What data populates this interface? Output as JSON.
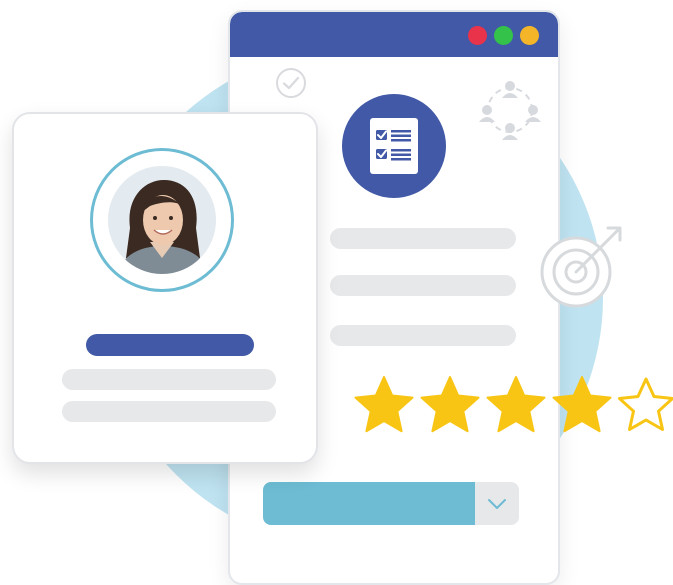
{
  "colors": {
    "primary_blue": "#4159a6",
    "accent_teal": "#6dbcd3",
    "light_blue_bg": "#bfe3f1",
    "placeholder_gray": "#e7e8ea",
    "star_gold": "#f8c514",
    "window_red": "#e8334a",
    "window_green": "#34c24a",
    "window_yellow": "#f4b628"
  },
  "icons": {
    "window_controls": [
      "close-dot",
      "maximize-dot",
      "minimize-dot"
    ],
    "check": "check-circle-icon",
    "team": "team-network-icon",
    "checklist": "checklist-icon",
    "target": "target-icon",
    "chevron": "chevron-down-icon"
  },
  "rating": {
    "value": 4,
    "max": 5
  },
  "dropdown": {
    "fill_fraction": 0.83
  }
}
